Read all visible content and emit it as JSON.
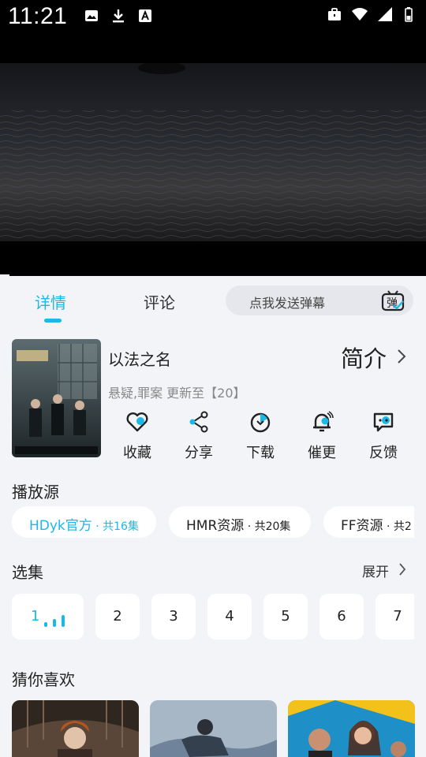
{
  "status_bar": {
    "time": "11:21",
    "left_icons": [
      "image-icon",
      "download-icon",
      "a-icon"
    ],
    "right_icons": [
      "briefcase-icon",
      "wifi-icon",
      "signal-icon",
      "battery-icon"
    ]
  },
  "tabs": [
    {
      "label": "详情",
      "active": true
    },
    {
      "label": "评论",
      "active": false
    }
  ],
  "danmaku": {
    "placeholder": "点我发送弹幕",
    "icon_text": "弹"
  },
  "show": {
    "title": "以法之名",
    "intro_label": "简介",
    "meta": "悬疑,罪案 更新至【20】"
  },
  "actions": [
    {
      "label": "收藏",
      "icon": "heart-icon"
    },
    {
      "label": "分享",
      "icon": "share-icon"
    },
    {
      "label": "下载",
      "icon": "download-icon"
    },
    {
      "label": "催更",
      "icon": "bell-icon"
    },
    {
      "label": "反馈",
      "icon": "feedback-icon"
    }
  ],
  "sources": {
    "title": "播放源",
    "items": [
      {
        "name": "HDyk官方",
        "count": " · 共16集",
        "active": true
      },
      {
        "name": "HMR资源",
        "count": " · 共20集",
        "active": false
      },
      {
        "name": "FF资源",
        "count": " · 共2",
        "active": false
      }
    ]
  },
  "episodes": {
    "title": "选集",
    "expand_label": "展开",
    "items": [
      "1",
      "2",
      "3",
      "4",
      "5",
      "6",
      "7"
    ],
    "active_index": 0
  },
  "recommend": {
    "title": "猜你喜欢"
  },
  "colors": {
    "accent": "#1cb8e6",
    "background": "#f3f4f7",
    "card": "#ffffff"
  }
}
